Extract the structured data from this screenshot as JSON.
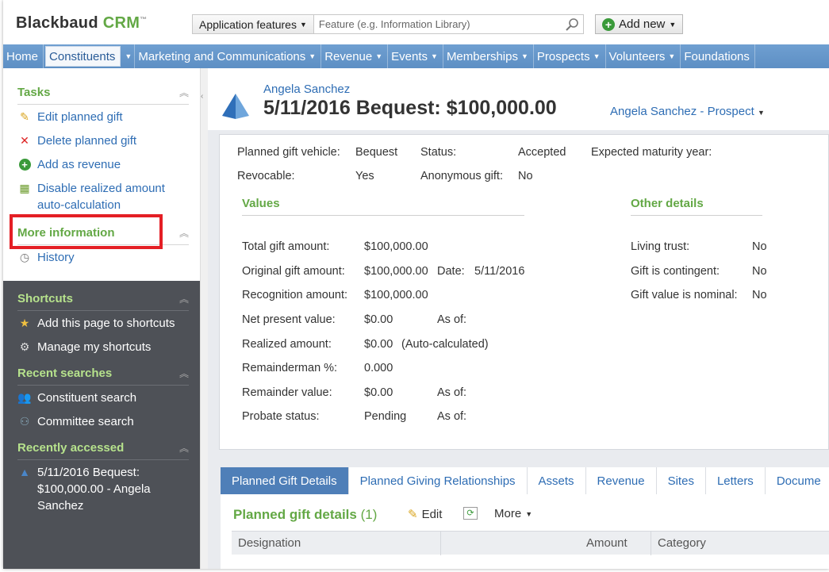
{
  "header": {
    "logo_text": "Blackbaud",
    "logo_product": "CRM",
    "app_features_label": "Application features",
    "feature_search_placeholder": "Feature (e.g. Information Library)",
    "add_new_label": "Add new"
  },
  "nav": {
    "items": [
      {
        "label": "Home"
      },
      {
        "label": "Constituents"
      },
      {
        "label": "Marketing and Communications"
      },
      {
        "label": "Revenue"
      },
      {
        "label": "Events"
      },
      {
        "label": "Memberships"
      },
      {
        "label": "Prospects"
      },
      {
        "label": "Volunteers"
      },
      {
        "label": "Foundations"
      }
    ]
  },
  "sidebar": {
    "tasks_title": "Tasks",
    "tasks": [
      {
        "label": "Edit planned gift",
        "icon": "pencil-icon"
      },
      {
        "label": "Delete planned gift",
        "icon": "delete-x-icon"
      },
      {
        "label": "Add as revenue",
        "icon": "add-circle-icon"
      },
      {
        "label": "Disable realized amount auto-calculation",
        "icon": "calculator-icon"
      }
    ],
    "more_info_title": "More information",
    "more_info": [
      {
        "label": "History",
        "icon": "history-icon"
      }
    ],
    "shortcuts_title": "Shortcuts",
    "shortcuts": [
      {
        "label": "Add this page to shortcuts",
        "icon": "star-icon"
      },
      {
        "label": "Manage my shortcuts",
        "icon": "gear-icon"
      }
    ],
    "recent_searches_title": "Recent searches",
    "recent_searches": [
      {
        "label": "Constituent search",
        "icon": "people-icon"
      },
      {
        "label": "Committee search",
        "icon": "committee-icon"
      }
    ],
    "recently_accessed_title": "Recently accessed",
    "recently_accessed": [
      {
        "label": "5/11/2016 Bequest: $100,000.00 - Angela Sanchez",
        "icon": "pyramid-icon"
      }
    ]
  },
  "record": {
    "constituent_name": "Angela Sanchez",
    "title": "5/11/2016 Bequest: $100,000.00",
    "prospect_link": "Angela Sanchez - Prospect"
  },
  "summary": {
    "vehicle_label": "Planned gift vehicle:",
    "vehicle_value": "Bequest",
    "status_label": "Status:",
    "status_value": "Accepted",
    "maturity_label": "Expected maturity year:",
    "revocable_label": "Revocable:",
    "revocable_value": "Yes",
    "anonymous_label": "Anonymous gift:",
    "anonymous_value": "No",
    "values_title": "Values",
    "other_title": "Other details",
    "total_label": "Total gift amount:",
    "total_value": "$100,000.00",
    "original_label": "Original gift amount:",
    "original_value": "$100,000.00",
    "date_label": "Date:",
    "date_value": "5/11/2016",
    "recognition_label": "Recognition amount:",
    "recognition_value": "$100,000.00",
    "npv_label": "Net present value:",
    "npv_value": "$0.00",
    "as_of_label": "As of:",
    "realized_label": "Realized amount:",
    "realized_value": "$0.00",
    "realized_note": "(Auto-calculated)",
    "remainderman_label": "Remainderman %:",
    "remainderman_value": "0.000",
    "remainder_label": "Remainder value:",
    "remainder_value": "$0.00",
    "probate_label": "Probate status:",
    "probate_value": "Pending",
    "living_trust_label": "Living trust:",
    "living_trust_value": "No",
    "contingent_label": "Gift is contingent:",
    "contingent_value": "No",
    "nominal_label": "Gift value is nominal:",
    "nominal_value": "No"
  },
  "tabs": [
    {
      "label": "Planned Gift Details"
    },
    {
      "label": "Planned Giving Relationships"
    },
    {
      "label": "Assets"
    },
    {
      "label": "Revenue"
    },
    {
      "label": "Sites"
    },
    {
      "label": "Letters"
    },
    {
      "label": "Docume"
    }
  ],
  "details": {
    "title": "Planned gift details",
    "count": "(1)",
    "edit_label": "Edit",
    "more_label": "More",
    "columns": [
      "Designation",
      "Amount",
      "Category"
    ]
  },
  "colors": {
    "accent_green": "#63a845",
    "link_blue": "#2e6db4",
    "nav_blue": "#5d8fc4",
    "highlight_red": "#e41f25"
  }
}
